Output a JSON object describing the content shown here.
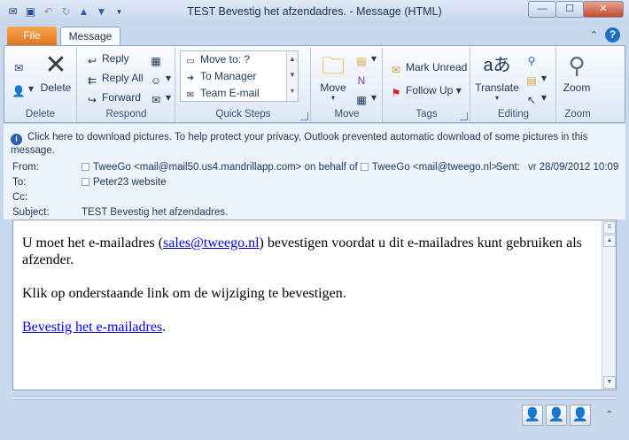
{
  "window": {
    "title": "TEST Bevestig het afzendadres.  -  Message (HTML)",
    "qat_icons": [
      "mail-icon",
      "save-icon",
      "undo-icon",
      "redo-icon",
      "up-arrow-icon",
      "down-arrow-icon",
      "customize-qat-icon"
    ],
    "minimize": "—",
    "maximize": "☐",
    "close": "✕"
  },
  "tabs": {
    "file": "File",
    "message": "Message"
  },
  "ribbon": {
    "delete_group": {
      "label": "Delete",
      "delete_button": "Delete"
    },
    "respond_group": {
      "label": "Respond",
      "reply": "Reply",
      "reply_all": "Reply All",
      "forward": "Forward"
    },
    "quick_steps_group": {
      "label": "Quick Steps",
      "items": [
        "Move to: ?",
        "To Manager",
        "Team E-mail"
      ]
    },
    "move_group": {
      "label": "Move",
      "move_button": "Move"
    },
    "tags_group": {
      "label": "Tags",
      "mark_unread": "Mark Unread",
      "follow_up": "Follow Up"
    },
    "editing_group": {
      "label": "Editing",
      "translate": "Translate"
    },
    "zoom_group": {
      "label": "Zoom",
      "zoom_button": "Zoom"
    }
  },
  "info_bar": "Click here to download pictures. To help protect your privacy, Outlook prevented automatic download of some pictures in this message.",
  "headers": {
    "from_label": "From:",
    "from_value": "TweeGo <mail@mail50.us4.mandrillapp.com> on behalf of",
    "from_sender": "TweeGo <mail@tweego.nl>",
    "sent_label": "Sent:",
    "sent_value": "vr 28/09/2012 10:09",
    "to_label": "To:",
    "to_value": "Peter23 website",
    "cc_label": "Cc:",
    "cc_value": "",
    "subject_label": "Subject:",
    "subject_value": "TEST Bevestig het afzendadres."
  },
  "body": {
    "para1_before": "U moet het e-mailadres (",
    "para1_link": "sales@tweego.nl",
    "para1_after": ") bevestigen voordat u dit e-mailadres kunt gebruiken als afzender.",
    "para2": "Klik op onderstaande link om de wijziging te bevestigen.",
    "link2": "Bevestig het e-mailadres",
    "link2_after": "."
  },
  "colors": {
    "file_tab": "#e3741a",
    "link": "#0000ee",
    "accent": "#1f6fc6"
  }
}
